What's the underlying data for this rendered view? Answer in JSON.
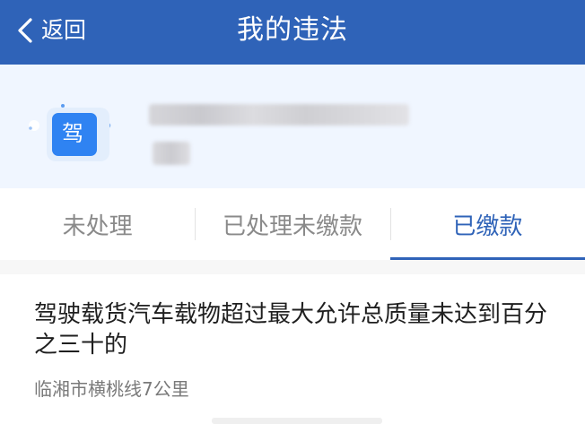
{
  "header": {
    "back_label": "返回",
    "title": "我的违法",
    "background_color": "#2f63b8",
    "back_icon": "chevron-left-icon"
  },
  "license": {
    "icon_char": "驾",
    "icon": "driver-license-icon"
  },
  "tabs": [
    {
      "label": "未处理",
      "active": false
    },
    {
      "label": "已处理未缴款",
      "active": false
    },
    {
      "label": "已缴款",
      "active": true
    }
  ],
  "violation": {
    "title": "驾驶载货汽车载物超过最大允许总质量未达到百分之三十的",
    "location": "临湘市横桃线7公里"
  },
  "colors": {
    "accent": "#2f63b8",
    "inactive_tab": "#8a8a8a",
    "location_text": "#7a7a7a"
  }
}
